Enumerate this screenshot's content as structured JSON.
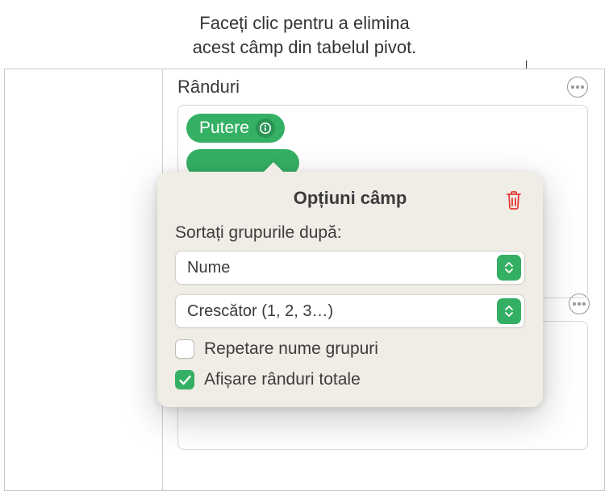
{
  "annotation": {
    "line1": "Faceți clic pentru a elimina",
    "line2": "acest câmp din tabelul pivot."
  },
  "section": {
    "title": "Rânduri"
  },
  "field_chip": {
    "label": "Putere"
  },
  "popover": {
    "title": "Opțiuni câmp",
    "sort_label": "Sortați grupurile după:",
    "sort_by": {
      "selected": "Nume"
    },
    "sort_order": {
      "selected": "Crescător (1, 2, 3…)"
    },
    "repeat_groups": {
      "label": "Repetare nume grupuri",
      "checked": false
    },
    "show_totals": {
      "label": "Afișare rânduri totale",
      "checked": true
    }
  }
}
